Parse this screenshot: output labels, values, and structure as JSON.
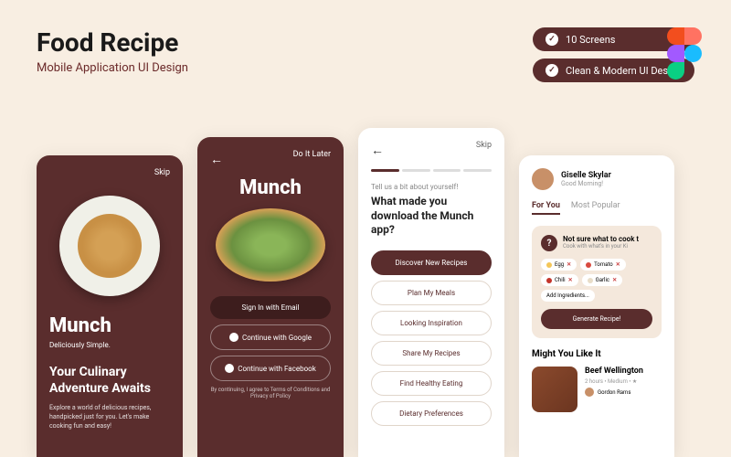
{
  "header": {
    "title": "Food Recipe",
    "subtitle": "Mobile Application UI Design",
    "badges": [
      "10 Screens",
      "Clean & Modern UI Design"
    ]
  },
  "screen1": {
    "skip": "Skip",
    "brand": "Munch",
    "tagline": "Deliciously Simple.",
    "heading": "Your Culinary Adventure Awaits",
    "desc": "Explore a world of delicious recipes, handpicked just for you. Let's make cooking fun and easy!"
  },
  "screen2": {
    "later": "Do It Later",
    "brand": "Munch",
    "email": "Sign In with Email",
    "google": "Continue with Google",
    "facebook": "Continue with Facebook",
    "legal": "By continuing, I agree to Terms of Conditions and Privacy of Policy"
  },
  "screen3": {
    "skip": "Skip",
    "sub": "Tell us a bit about yourself!",
    "heading": "What made you download the Munch app?",
    "options": [
      "Discover New Recipes",
      "Plan My Meals",
      "Looking Inspiration",
      "Share My Recipes",
      "Find Healthy Eating",
      "Dietary Preferences"
    ]
  },
  "screen4": {
    "user_name": "Giselle Skylar",
    "greeting": "Good Morning!",
    "tabs": [
      "For You",
      "Most Popular"
    ],
    "card_title": "Not sure what to cook t",
    "card_sub": "Cook with what's in your Ki",
    "chips": [
      {
        "label": "Egg",
        "color": "#f4c658"
      },
      {
        "label": "Tomato",
        "color": "#d84a3f"
      },
      {
        "label": "Chili",
        "color": "#c4342a"
      },
      {
        "label": "Garlic",
        "color": "#e8ddc8"
      }
    ],
    "add_label": "Add Ingredients...",
    "generate": "Generate Recipe!",
    "section": "Might You Like It",
    "recipe_title": "Beef Wellington",
    "recipe_meta": "2 hours • Medium • ★",
    "chef": "Gordon Rams"
  }
}
